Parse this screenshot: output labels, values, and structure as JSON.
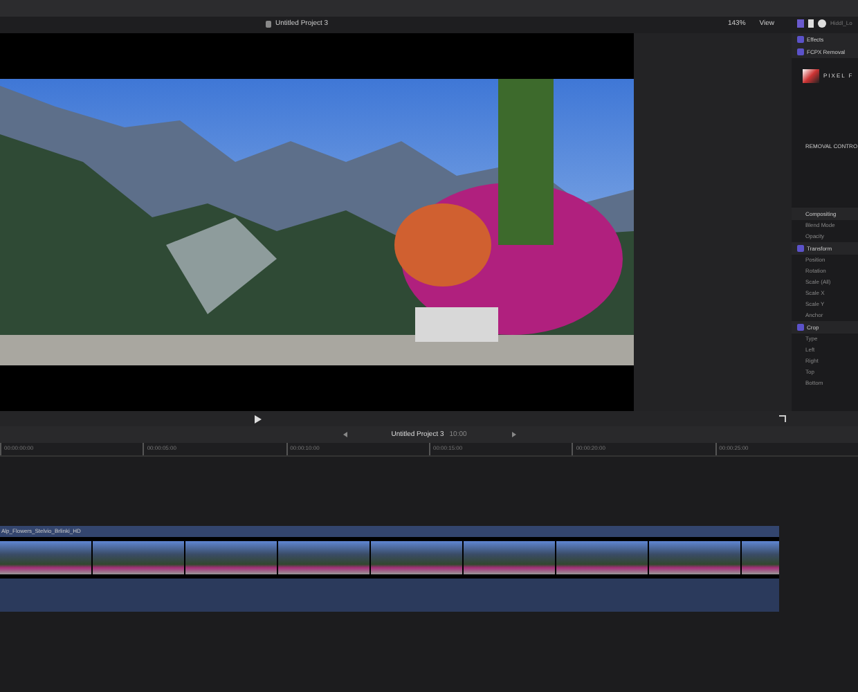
{
  "toolbar": {
    "project_title": "Untitled Project 3",
    "zoom": "143%",
    "view": "View",
    "inspector_title": "Hiddl_Lo"
  },
  "inspector": {
    "effects": [
      {
        "label": "Effects",
        "checked": true
      },
      {
        "label": "FCPX Removal",
        "checked": true
      }
    ],
    "plugin_logo": "PIXEL F",
    "plugin_subtitle": "REMOVAL CONTRO",
    "sections": [
      {
        "label": "Compositing",
        "checked": false,
        "params": [
          "Blend Mode",
          "Opacity"
        ]
      },
      {
        "label": "Transform",
        "checked": true,
        "params": [
          "Position",
          "Rotation",
          "Scale (All)",
          "Scale X",
          "Scale Y",
          "Anchor"
        ]
      },
      {
        "label": "Crop",
        "checked": true,
        "params": [
          "Type",
          "Left",
          "Right",
          "Top",
          "Bottom"
        ]
      }
    ]
  },
  "timeline": {
    "project": "Untitled Project 3",
    "duration": "10:00",
    "ruler": [
      "00:00:00:00",
      "00:00:05:00",
      "00:00:10:00",
      "00:00:15:00",
      "00:00:20:00",
      "00:00:25:00"
    ],
    "clip": {
      "name": "Alp_Flowers_Stelvio_Brlinki_HD"
    }
  }
}
